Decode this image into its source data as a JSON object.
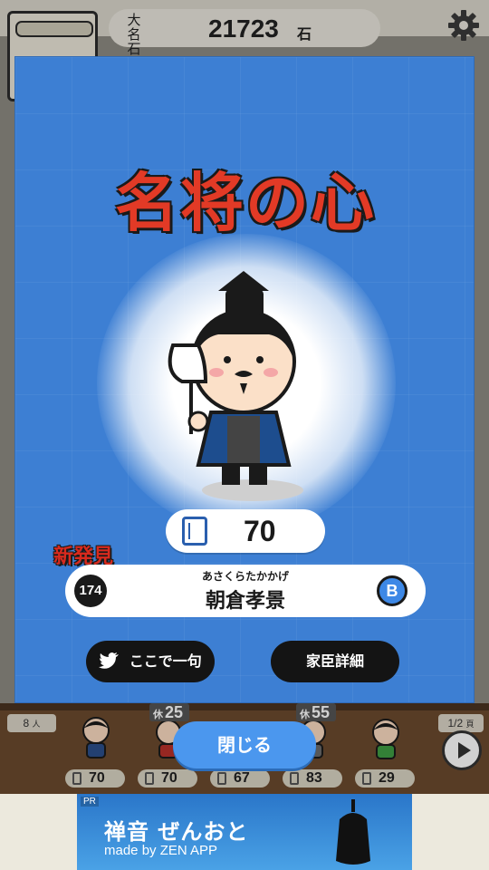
{
  "header": {
    "currency_icon_text": "大\n名石",
    "currency_value": "21723",
    "currency_unit": "石"
  },
  "modal": {
    "title": "名将の心",
    "score": "70",
    "new_badge": "新発見",
    "retainer_number": "174",
    "furigana": "あさくらたかかげ",
    "name": "朝倉孝景",
    "rank": "B",
    "haiku_button": "ここで一句",
    "details_button": "家臣詳細"
  },
  "footer": {
    "person_count": "8",
    "person_unit": "人",
    "page_indicator": "1/2",
    "page_suffix": "頁",
    "close_button": "閉じる",
    "rest_label": "休",
    "rest_tags": [
      "25",
      "55"
    ],
    "roster_values": [
      "70",
      "70",
      "67",
      "83",
      "29"
    ]
  },
  "ad": {
    "pr": "PR",
    "title": "禅音 ぜんおと",
    "subtitle": "made by ZEN APP"
  },
  "colors": {
    "modal_bg": "#3d7fd3",
    "title_red": "#e23a26",
    "button_dark": "#141414",
    "close_blue": "#4b97ee"
  }
}
